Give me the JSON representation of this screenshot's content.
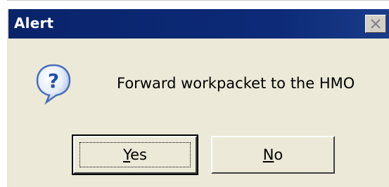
{
  "dialog": {
    "title": "Alert",
    "message": "Forward workpacket to the HMO",
    "icon": "question-icon",
    "close_icon": "close-icon"
  },
  "buttons": {
    "yes": {
      "mnemonic": "Y",
      "rest": "es"
    },
    "no": {
      "mnemonic": "N",
      "rest": "o"
    }
  },
  "colors": {
    "titlebar": "#0a246a",
    "dialog_bg": "#ece9d8",
    "icon_blue": "#2e5fbf"
  }
}
